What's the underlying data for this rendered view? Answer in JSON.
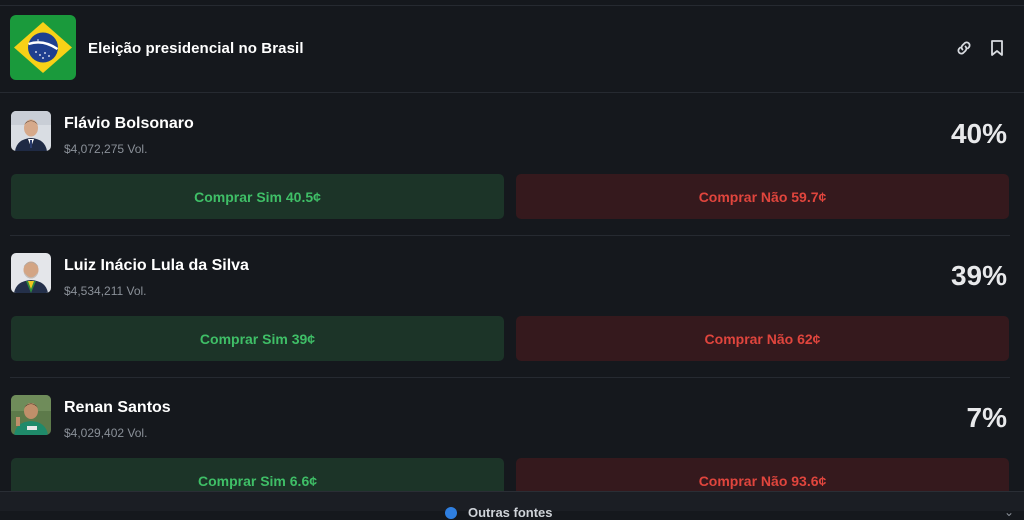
{
  "market": {
    "title": "Eleição presidencial no Brasil",
    "flag_icon": "brazil-flag",
    "link_icon": "link-icon",
    "bookmark_icon": "bookmark-icon"
  },
  "candidates": [
    {
      "name": "Flávio Bolsonaro",
      "volume": "$4,072,275 Vol.",
      "percent": "40%",
      "buy_yes": "Comprar Sim 40.5¢",
      "buy_no": "Comprar Não 59.7¢"
    },
    {
      "name": "Luiz Inácio Lula da Silva",
      "volume": "$4,534,211 Vol.",
      "percent": "39%",
      "buy_yes": "Comprar Sim 39¢",
      "buy_no": "Comprar Não 62¢"
    },
    {
      "name": "Renan Santos",
      "volume": "$4,029,402 Vol.",
      "percent": "7%",
      "buy_yes": "Comprar Sim 6.6¢",
      "buy_no": "Comprar Não 93.6¢"
    }
  ],
  "bottom": {
    "label": "Outras fontes"
  },
  "colors": {
    "background": "#15181d",
    "yes_bg": "#1c3428",
    "yes_text": "#3fbf67",
    "no_bg": "#35191d",
    "no_text": "#e0453d"
  }
}
